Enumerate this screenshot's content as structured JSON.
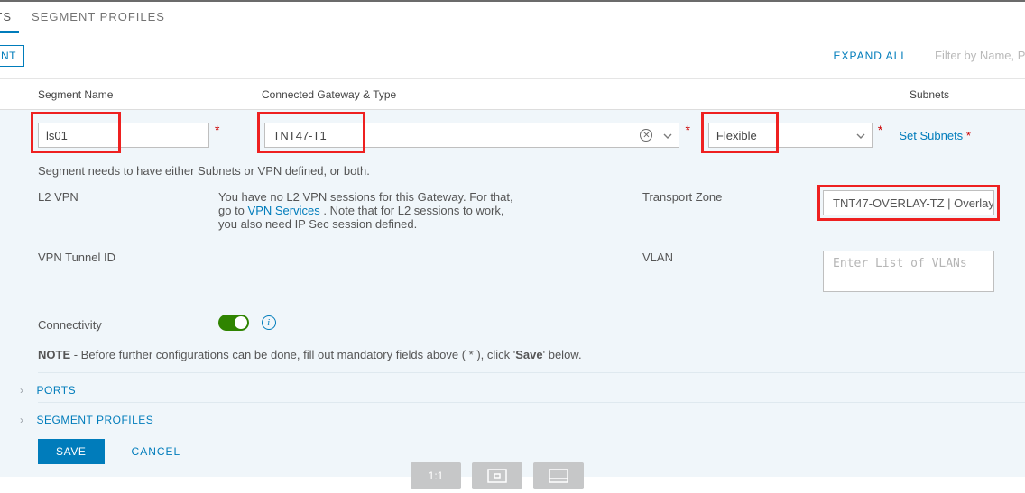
{
  "tabs": {
    "segments": "NTS",
    "profiles": "SEGMENT PROFILES"
  },
  "action": {
    "add": "NT",
    "expand": "EXPAND ALL",
    "filter_placeholder": "Filter by Name, Path o"
  },
  "headers": {
    "name": "Segment Name",
    "gateway": "Connected Gateway & Type",
    "subnets": "Subnets"
  },
  "form": {
    "segment_name": "ls01",
    "gateway": "TNT47-T1",
    "type": "Flexible",
    "set_subnets": "Set Subnets",
    "hint": "Segment needs to have either Subnets or VPN defined, or both.",
    "l2vpn_label": "L2 VPN",
    "l2vpn_text1": "You have no L2 VPN sessions for this Gateway. For that,",
    "l2vpn_text2a": "go to ",
    "l2vpn_link": "VPN Services",
    "l2vpn_text2b": " . Note that for L2 sessions to work,",
    "l2vpn_text3": "you also need IP Sec session defined.",
    "tunnel_label": "VPN Tunnel ID",
    "tz_label": "Transport Zone",
    "tz_value": "TNT47-OVERLAY-TZ | Overlay",
    "vlan_label": "VLAN",
    "vlan_placeholder": "Enter List of VLANs",
    "conn_label": "Connectivity",
    "note_prefix": "NOTE",
    "note_text": " - Before further configurations can be done, fill out mandatory fields above ( * ), click '",
    "note_bold": "Save",
    "note_suffix": "' below."
  },
  "expanders": {
    "ports": "PORTS",
    "profiles": "SEGMENT PROFILES"
  },
  "buttons": {
    "save": "SAVE",
    "cancel": "CANCEL"
  },
  "bottom_icons": {
    "ratio": "1:1"
  }
}
